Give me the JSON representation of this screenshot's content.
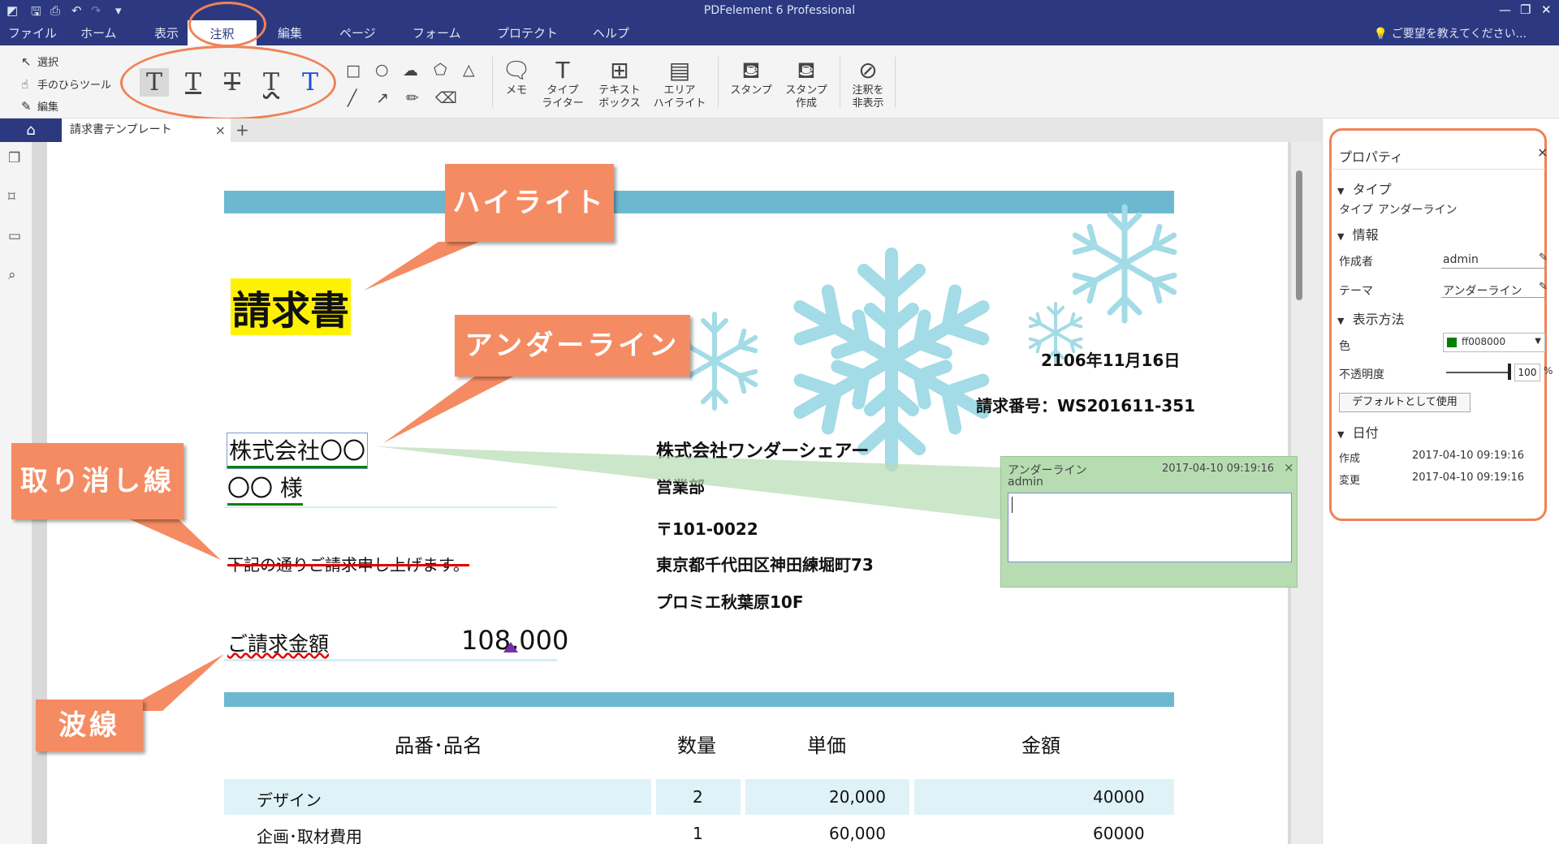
{
  "titlebar": {
    "app_title": "PDFelement 6 Professional"
  },
  "menu": {
    "items": [
      "ファイル",
      "ホーム",
      "表示",
      "注釈",
      "編集",
      "ページ",
      "フォーム",
      "プロテクト",
      "ヘルプ"
    ],
    "help_placeholder": "ご要望を教えてください..."
  },
  "ribbon": {
    "select": "選択",
    "hand": "手のひらツール",
    "edit": "編集",
    "memo": "メモ",
    "typewriter": [
      "タイプ",
      "ライター"
    ],
    "textbox": [
      "テキスト",
      "ボックス"
    ],
    "area_highlight": [
      "エリア",
      "ハイライト"
    ],
    "stamp": "スタンプ",
    "stamp_create": [
      "スタンプ",
      "作成"
    ],
    "hide_annot": [
      "注釈を",
      "非表示"
    ]
  },
  "tabs": {
    "doc_title": "請求書テンプレート"
  },
  "document": {
    "title": "請求書",
    "client_company": "株式会社〇〇",
    "client_person": "〇〇 様",
    "date": "2106年11月16日",
    "invoice_no": "請求番号：WS201611-351",
    "issuer_company": "株式会社ワンダーシェアー",
    "issuer_dept": "営業部",
    "issuer_zip": "〒101-0022",
    "issuer_address": "東京都千代田区神田練堀町73",
    "issuer_building": "プロミエ秋葉原10F",
    "intro": "下記の通りご請求申し上げます。",
    "amount_label": "ご請求金額",
    "amount_value": "108,000",
    "table": {
      "headers": [
        "品番･品名",
        "数量",
        "単価",
        "金額"
      ],
      "rows": [
        [
          "デザイン",
          "2",
          "20,000",
          "40000"
        ],
        [
          "企画･取材費用",
          "1",
          "60,000",
          "60000"
        ]
      ]
    }
  },
  "callouts": {
    "highlight": "ハイライト",
    "underline": "アンダーライン",
    "strikeout": "取り消し線",
    "squiggly": "波線"
  },
  "note": {
    "type": "アンダーライン",
    "author": "admin",
    "timestamp": "2017-04-10 09:19:16"
  },
  "properties": {
    "title": "プロパティ",
    "sec_type": "タイプ",
    "type_label": "タイプ",
    "type_value": "アンダーライン",
    "sec_info": "情報",
    "author_label": "作成者",
    "author_value": "admin",
    "theme_label": "テーマ",
    "theme_value": "アンダーライン",
    "sec_display": "表示方法",
    "color_label": "色",
    "color_value": "ff008000",
    "opacity_label": "不透明度",
    "opacity_value": "100",
    "opacity_unit": "%",
    "default_button": "デフォルトとして使用",
    "sec_date": "日付",
    "created_label": "作成",
    "created_value": "2017-04-10 09:19:16",
    "modified_label": "変更",
    "modified_value": "2017-04-10 09:19:16"
  },
  "colors": {
    "accent": "#2c3980",
    "callout": "#f58b62",
    "band": "#6db8d0",
    "highlight": "#fff200",
    "underline": "#008000",
    "strike": "#e00000",
    "squiggly": "#e00000"
  }
}
